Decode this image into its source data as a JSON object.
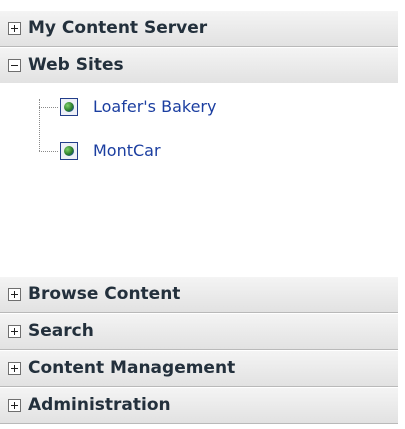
{
  "sections": {
    "my_content_server": {
      "label": "My Content Server",
      "state": "collapsed"
    },
    "web_sites": {
      "label": "Web Sites",
      "state": "expanded"
    },
    "browse_content": {
      "label": "Browse Content",
      "state": "collapsed"
    },
    "search": {
      "label": "Search",
      "state": "collapsed"
    },
    "content_management": {
      "label": "Content Management",
      "state": "collapsed"
    },
    "administration": {
      "label": "Administration",
      "state": "collapsed"
    }
  },
  "web_sites_tree": {
    "items": [
      {
        "label": "Loafer's Bakery",
        "icon": "website-globe-icon"
      },
      {
        "label": "MontCar",
        "icon": "website-globe-icon"
      }
    ]
  },
  "colors": {
    "header_text": "#23303c",
    "link_text": "#1b3ea0",
    "header_border": "#b9b9b9"
  }
}
